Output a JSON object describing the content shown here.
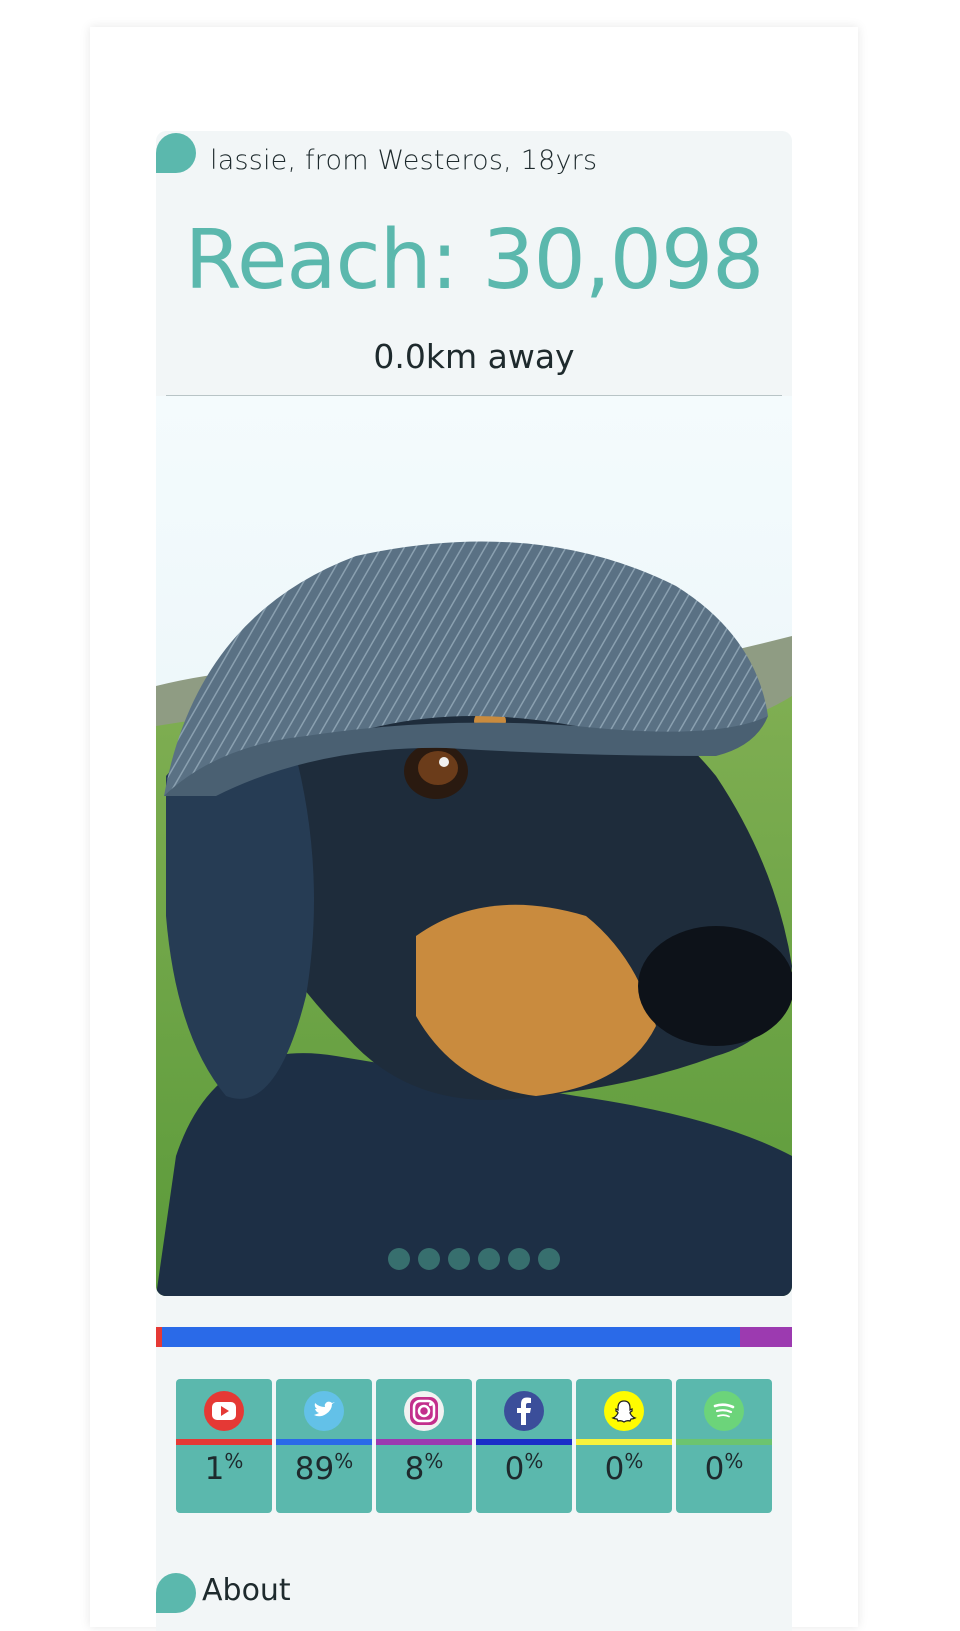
{
  "profile": {
    "subtitle": "lassie, from Westeros, 18yrs",
    "reach": "Reach: 30,098",
    "distance": "0.0km away"
  },
  "carousel": {
    "slide_count": 6,
    "active_index": 0
  },
  "share_bar": [
    {
      "network": "youtube",
      "percent": 1,
      "color": "#e53935"
    },
    {
      "network": "twitter",
      "percent": 89,
      "color": "#2a6ae8"
    },
    {
      "network": "instagram",
      "percent": 8,
      "color": "#9c3ab0"
    },
    {
      "network": "facebook",
      "percent": 0,
      "color": "#1a2dc8"
    },
    {
      "network": "snapchat",
      "percent": 0,
      "color": "#f7f33c"
    },
    {
      "network": "spotify",
      "percent": 0,
      "color": "#6cc46f"
    }
  ],
  "networks": [
    {
      "name": "youtube",
      "icon": "youtube-icon",
      "value": "1",
      "unit": "%",
      "color": "#e53935"
    },
    {
      "name": "twitter",
      "icon": "twitter-icon",
      "value": "89",
      "unit": "%",
      "color": "#2a6ae8"
    },
    {
      "name": "instagram",
      "icon": "instagram-icon",
      "value": "8",
      "unit": "%",
      "color": "#9c3ab0"
    },
    {
      "name": "facebook",
      "icon": "facebook-icon",
      "value": "0",
      "unit": "%",
      "color": "#1a2dc8"
    },
    {
      "name": "snapchat",
      "icon": "snapchat-icon",
      "value": "0",
      "unit": "%",
      "color": "#f7f33c"
    },
    {
      "name": "spotify",
      "icon": "spotify-icon",
      "value": "0",
      "unit": "%",
      "color": "#6cc46f"
    }
  ],
  "sections": {
    "about_label": "About"
  },
  "colors": {
    "accent": "#5bb8ad",
    "card_background": "#f2f6f7"
  }
}
